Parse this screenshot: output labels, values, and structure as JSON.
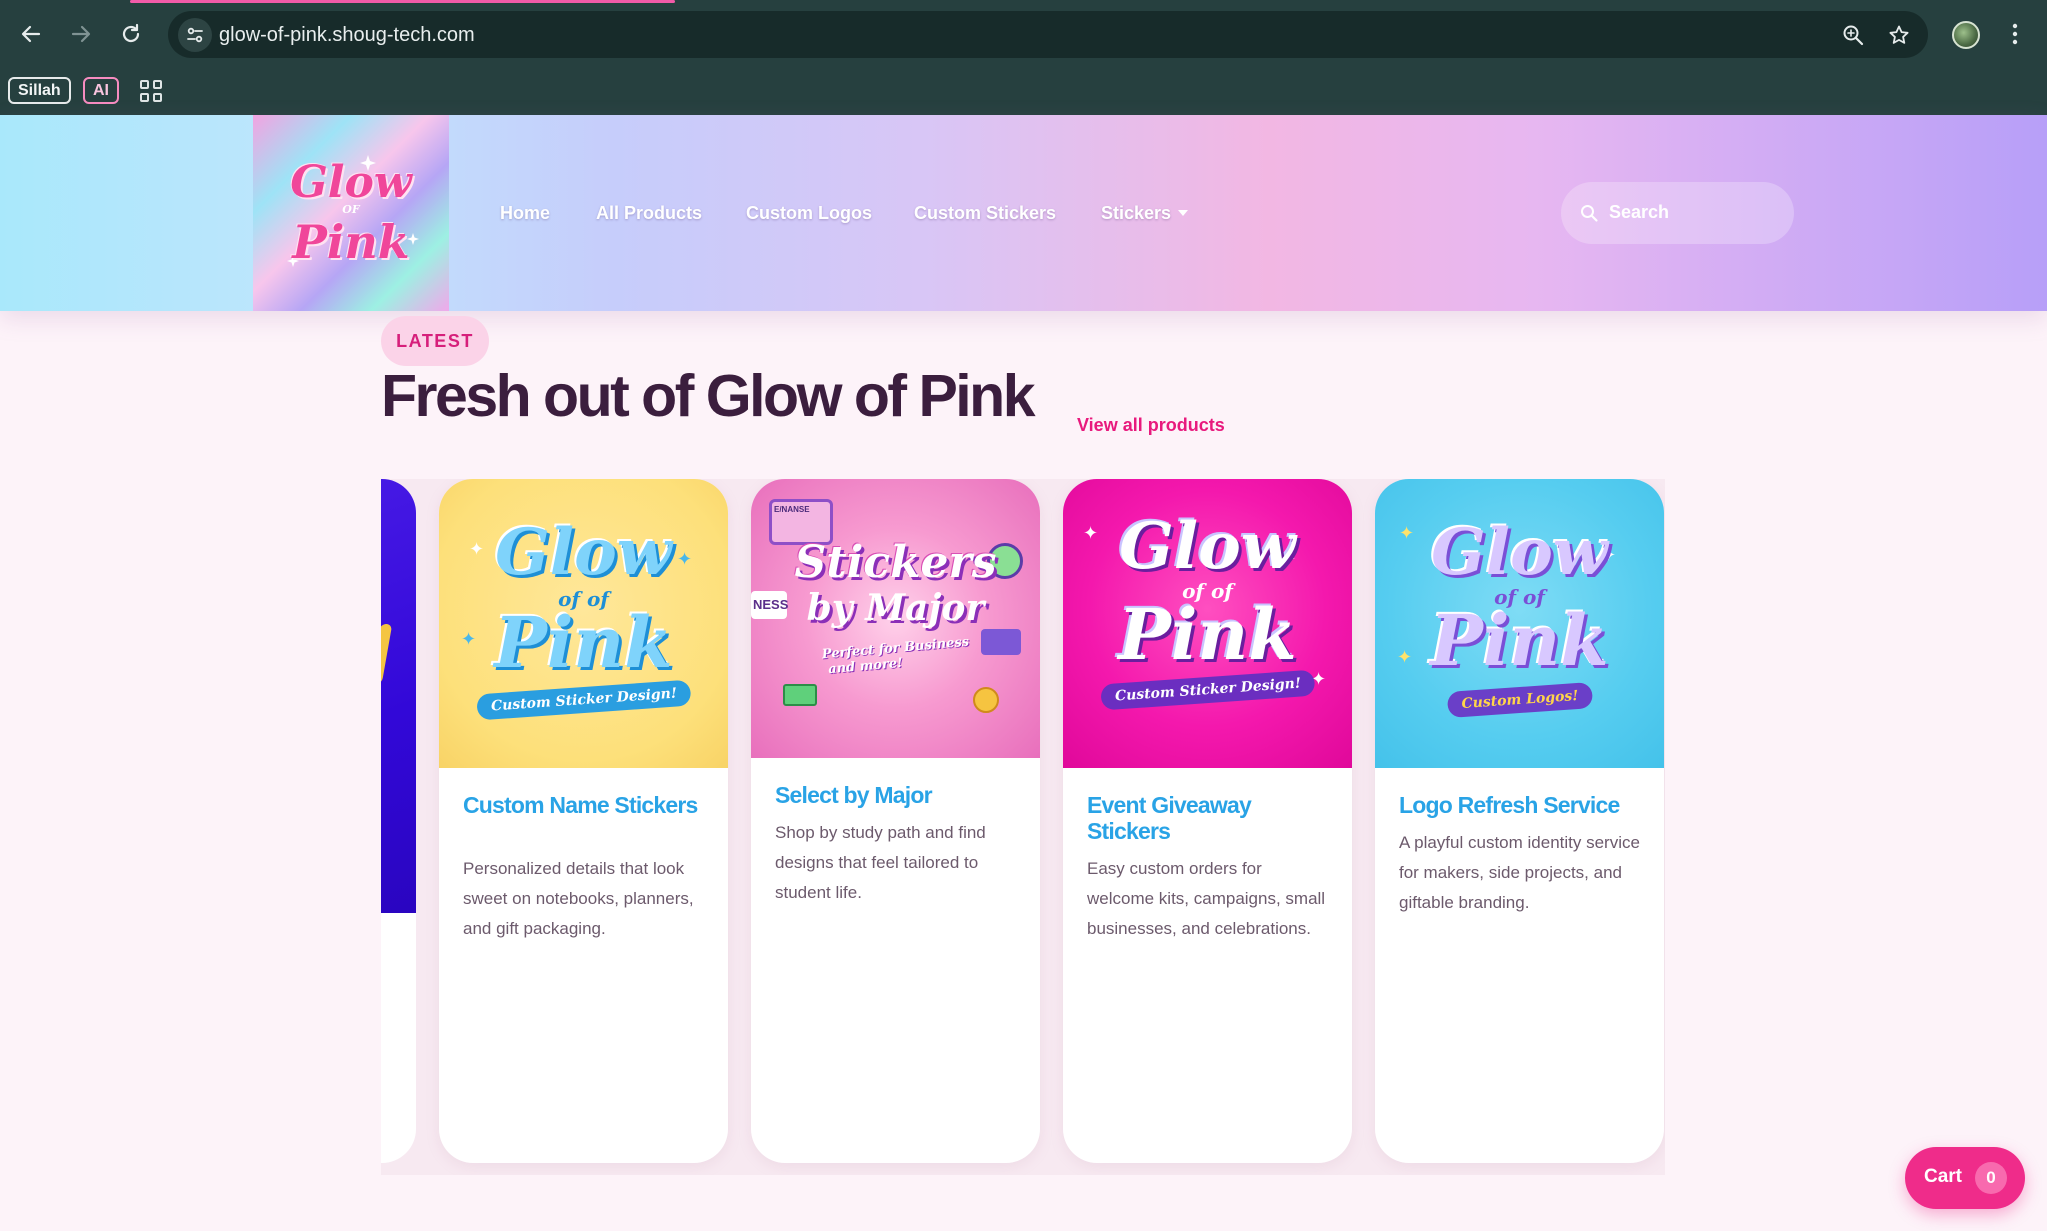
{
  "browser": {
    "url": "glow-of-pink.shoug-tech.com",
    "bookmarks": [
      "Sillah",
      "AI"
    ],
    "icons": [
      "back-arrow-icon",
      "forward-arrow-icon",
      "reload-icon",
      "site-settings-icon",
      "zoom-icon",
      "star-icon",
      "profile-avatar",
      "more-menu-icon",
      "apps-grid-icon"
    ]
  },
  "header": {
    "logo": {
      "line1": "Glow",
      "line2": "OF",
      "line3": "Pink"
    },
    "nav": [
      {
        "label": "Home"
      },
      {
        "label": "All Products"
      },
      {
        "label": "Custom Logos"
      },
      {
        "label": "Custom Stickers"
      },
      {
        "label": "Stickers",
        "has_dropdown": true
      }
    ],
    "search": {
      "placeholder": "Search"
    }
  },
  "section": {
    "badge": "LATEST",
    "title": "Fresh out of Glow of Pink",
    "view_all": "View all products"
  },
  "products": [
    {
      "title": "Custom Name Stickers",
      "description": "Personalized details that look sweet on notebooks, planners, and gift packaging.",
      "art": {
        "line1": "Glow",
        "line2": "of of",
        "line3": "Pink",
        "ribbon": "Custom Sticker Design!"
      }
    },
    {
      "title": "Select by Major",
      "description": "Shop by study path and find designs that feel tailored to student life.",
      "art": {
        "line1": "Stickers",
        "line2": "by Major",
        "line3": "Perfect for Business",
        "line4": "and more!",
        "tag": "E/NANSE",
        "side": "NESS"
      }
    },
    {
      "title": "Event Giveaway Stickers",
      "description": "Easy custom orders for welcome kits, campaigns, small businesses, and celebrations.",
      "art": {
        "line1": "Glow",
        "line2": "of of",
        "line3": "Pink",
        "ribbon": "Custom Sticker Design!"
      }
    },
    {
      "title": "Logo Refresh Service",
      "description": "A playful custom identity service for makers, side projects, and giftable branding.",
      "art": {
        "line1": "Glow",
        "line2": "of of",
        "line3": "Pink",
        "ribbon": "Custom Logos!"
      }
    }
  ],
  "cart": {
    "label": "Cart",
    "count": "0"
  },
  "colors": {
    "brand_pink": "#ef2c8a",
    "title_dark": "#3b1e3e",
    "card_title_blue": "#29a3e6",
    "page_bg": "#fdf3f9"
  }
}
